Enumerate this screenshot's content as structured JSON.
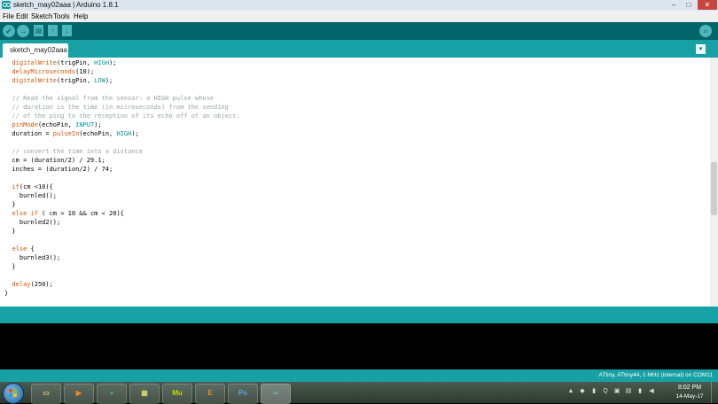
{
  "window": {
    "title": "sketch_may02aaa | Arduino 1.8.1",
    "minimize": "–",
    "maximize": "□",
    "close": "✕"
  },
  "menu": [
    "File",
    "Edit",
    "Sketch",
    "Tools",
    "Help"
  ],
  "toolbar": {
    "verify": "✓",
    "upload": "→",
    "new": "▤",
    "open": "↑",
    "save": "↓",
    "serial_monitor": "⌕"
  },
  "tabs": [
    {
      "label": "sketch_may02aaa"
    }
  ],
  "tab_menu": "▾",
  "code": [
    [
      [
        "  ",
        ""
      ],
      [
        "digitalWrite",
        "kw"
      ],
      [
        "(trigPin, ",
        ""
      ],
      [
        "HIGH",
        "cst"
      ],
      [
        ");",
        ""
      ]
    ],
    [
      [
        "  ",
        ""
      ],
      [
        "delayMicroseconds",
        "kw"
      ],
      [
        "(10);",
        ""
      ]
    ],
    [
      [
        "  ",
        ""
      ],
      [
        "digitalWrite",
        "kw"
      ],
      [
        "(trigPin, ",
        ""
      ],
      [
        "LOW",
        "cst"
      ],
      [
        ");",
        ""
      ]
    ],
    [],
    [
      [
        "  // Read the signal from the sensor: a HIGH pulse whose",
        "cm"
      ]
    ],
    [
      [
        "  // duration is the time (in microseconds) from the sending",
        "cm"
      ]
    ],
    [
      [
        "  // of the ping to the reception of its echo off of an object.",
        "cm"
      ]
    ],
    [
      [
        "  ",
        ""
      ],
      [
        "pinMode",
        "kw"
      ],
      [
        "(echoPin, ",
        ""
      ],
      [
        "INPUT",
        "cst"
      ],
      [
        ");",
        ""
      ]
    ],
    [
      [
        "  duration = ",
        ""
      ],
      [
        "pulseIn",
        "kw"
      ],
      [
        "(echoPin, ",
        ""
      ],
      [
        "HIGH",
        "cst"
      ],
      [
        ");",
        ""
      ]
    ],
    [],
    [
      [
        "  // convert the time into a distance",
        "cm"
      ]
    ],
    [
      [
        "  cm = (duration/2) / 29.1;",
        ""
      ]
    ],
    [
      [
        "  inches = (duration/2) / 74;",
        ""
      ]
    ],
    [],
    [
      [
        "  ",
        ""
      ],
      [
        "if",
        "kw"
      ],
      [
        "(cm <10){",
        ""
      ]
    ],
    [
      [
        "    burnled();",
        ""
      ]
    ],
    [
      [
        "  }",
        ""
      ]
    ],
    [
      [
        "  ",
        ""
      ],
      [
        "else",
        "kw"
      ],
      [
        " ",
        ""
      ],
      [
        "if",
        "kw"
      ],
      [
        " ( cm > 10 && cm < 20){",
        ""
      ]
    ],
    [
      [
        "    burnled2();",
        ""
      ]
    ],
    [
      [
        "  }",
        ""
      ]
    ],
    [],
    [
      [
        "  ",
        ""
      ],
      [
        "else",
        "kw"
      ],
      [
        " {",
        ""
      ]
    ],
    [
      [
        "    burnled3();",
        ""
      ]
    ],
    [
      [
        "  }",
        ""
      ]
    ],
    [],
    [
      [
        "  ",
        ""
      ],
      [
        "delay",
        "kw"
      ],
      [
        "(250);",
        ""
      ]
    ],
    [
      [
        "}",
        ""
      ]
    ]
  ],
  "status": {
    "board": "ATtiny, ATtiny44, 1 MHz (internal) on COM11"
  },
  "taskbar": {
    "apps": [
      {
        "name": "explorer",
        "glyph": "▭",
        "color": "#e8c15a"
      },
      {
        "name": "media-player",
        "glyph": "▶",
        "color": "#f08a1c"
      },
      {
        "name": "chrome",
        "glyph": "●",
        "color": "#3aa757"
      },
      {
        "name": "photos",
        "glyph": "▦",
        "color": "#d6d36a"
      },
      {
        "name": "muse",
        "glyph": "Mu",
        "color": "#c7d900"
      },
      {
        "name": "ebook",
        "glyph": "E",
        "color": "#e58a2c"
      },
      {
        "name": "photoshop",
        "glyph": "Ps",
        "color": "#4fa8e0"
      },
      {
        "name": "arduino",
        "glyph": "∞",
        "color": "#5fc6ca"
      }
    ],
    "tray": [
      "▲",
      "◆",
      "▮",
      "Q",
      "▣",
      "▤",
      "▮",
      "◀"
    ],
    "time": "8:02 PM",
    "date": "14-May-17"
  }
}
